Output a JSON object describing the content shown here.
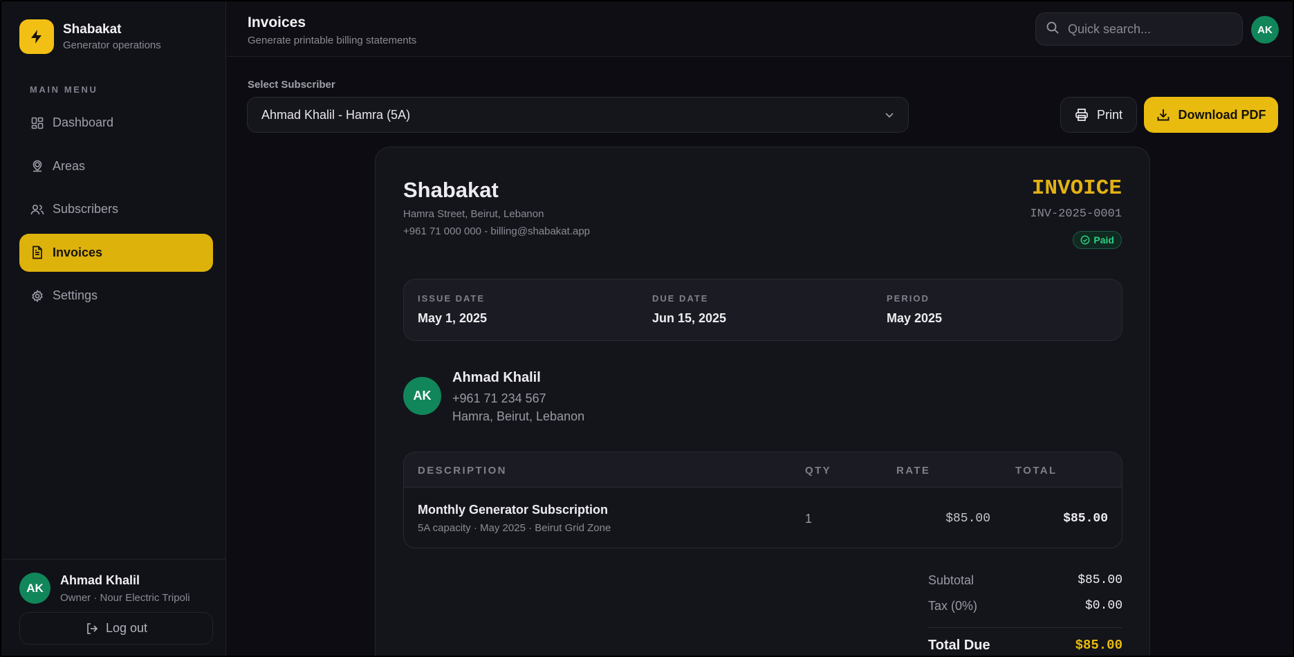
{
  "colors": {
    "accent": "#e9bb0f",
    "background": "#0c0c12",
    "sidebar": "#111118",
    "avatar": "#11865a",
    "paid": "#2fcf86"
  },
  "brand": {
    "name": "Shabakat",
    "subtitle": "Generator operations",
    "icon": "lightning-bolt-icon"
  },
  "sidebar": {
    "menu_title": "MAIN MENU",
    "items": [
      {
        "label": "Dashboard",
        "icon": "grid-icon",
        "active": false
      },
      {
        "label": "Areas",
        "icon": "map-pin-icon",
        "active": false
      },
      {
        "label": "Subscribers",
        "icon": "users-icon",
        "active": false
      },
      {
        "label": "Invoices",
        "icon": "document-icon",
        "active": true
      },
      {
        "label": "Settings",
        "icon": "gear-icon",
        "active": false
      }
    ],
    "user": {
      "initials": "AK",
      "name": "Ahmad Khalil",
      "role": "Owner · Nour Electric Tripoli"
    },
    "logout_label": "Log out"
  },
  "header": {
    "title": "Invoices",
    "subtitle": "Generate printable billing statements",
    "search_placeholder": "Quick search...",
    "avatar_initials": "AK"
  },
  "controls": {
    "select_label": "Select Subscriber",
    "selected_subscriber": "Ahmad Khalil - Hamra (5A)",
    "print_label": "Print",
    "download_label": "Download PDF"
  },
  "invoice": {
    "company": {
      "name": "Shabakat",
      "address": "Hamra Street, Beirut, Lebanon",
      "contact": "+961 71 000 000 - billing@shabakat.app"
    },
    "title": "INVOICE",
    "number": "INV-2025-0001",
    "status": "Paid",
    "dates": [
      {
        "label": "ISSUE DATE",
        "value": "May 1, 2025"
      },
      {
        "label": "DUE DATE",
        "value": "Jun 15, 2025"
      },
      {
        "label": "PERIOD",
        "value": "May 2025"
      }
    ],
    "customer": {
      "initials": "AK",
      "name": "Ahmad Khalil",
      "phone": "+961 71 234 567",
      "address": "Hamra, Beirut, Lebanon"
    },
    "columns": [
      "DESCRIPTION",
      "QTY",
      "RATE",
      "TOTAL"
    ],
    "line_items": [
      {
        "description": "Monthly Generator Subscription",
        "details": "5A capacity · May 2025 · Beirut Grid Zone",
        "qty": "1",
        "rate": "$85.00",
        "total": "$85.00"
      }
    ],
    "totals": {
      "subtotal_label": "Subtotal",
      "subtotal": "$85.00",
      "tax_label": "Tax (0%)",
      "tax": "$0.00",
      "total_label": "Total Due",
      "total": "$85.00"
    }
  }
}
